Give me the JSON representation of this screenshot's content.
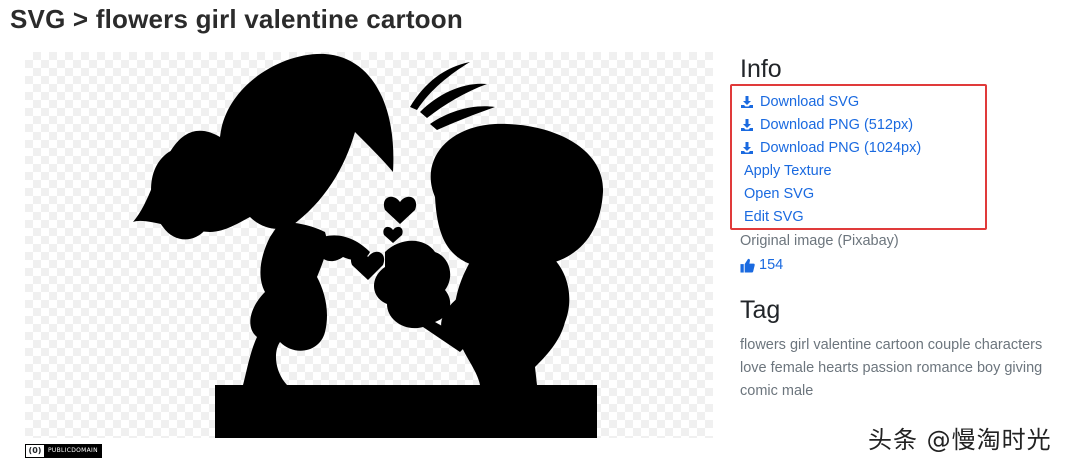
{
  "page": {
    "title": "SVG > flowers girl valentine cartoon"
  },
  "license_badge": {
    "icon_text": "(0)",
    "text": "PUBLICDOMAIN"
  },
  "info": {
    "heading": "Info",
    "links": [
      {
        "label": "Download SVG",
        "icon": "download-icon"
      },
      {
        "label": "Download PNG (512px)",
        "icon": "download-icon"
      },
      {
        "label": "Download PNG (1024px)",
        "icon": "download-icon"
      },
      {
        "label": "Apply Texture"
      },
      {
        "label": "Open SVG"
      },
      {
        "label": "Edit SVG"
      }
    ],
    "original_image": "Original image (Pixabay)",
    "likes": "154",
    "likes_icon": "thumbs-up-icon"
  },
  "tag": {
    "heading": "Tag",
    "text": "flowers girl valentine cartoon couple characters love female hearts passion romance boy giving comic male"
  },
  "watermark": "头条 @慢淘时光",
  "colors": {
    "link": "#1a6ae0",
    "muted": "#6c757d",
    "highlight_box": "#e03a3a"
  }
}
